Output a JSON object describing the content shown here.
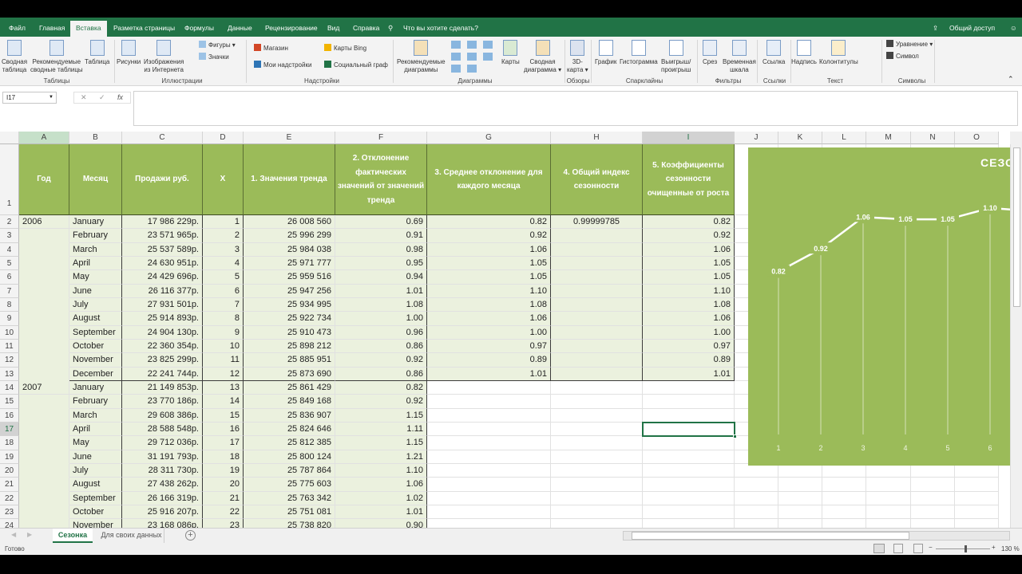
{
  "ribbon_tabs": [
    "Файл",
    "Главная",
    "Вставка",
    "Разметка страницы",
    "Формулы",
    "Данные",
    "Рецензирование",
    "Вид",
    "Справка"
  ],
  "active_tab": "Вставка",
  "tell_me": "Что вы хотите сделать?",
  "share": "Общий доступ",
  "ribbon": {
    "buttons": [
      "Сводная\nтаблица",
      "Рекомендуемые\nсводные таблицы",
      "Таблица",
      "Рисунки",
      "Изображения\nиз Интернета",
      "Рекомендуемые\nдиаграммы",
      "Карты",
      "Сводная\nдиаграмма ▾",
      "3D-\nкарта ▾",
      "График",
      "Гистограмма",
      "Выигрыш/\nпроигрыш",
      "Срез",
      "Временная\nшкала",
      "Ссылка",
      "Надпись",
      "Колонтитулы"
    ],
    "small": [
      "Фигуры ▾",
      "Значки",
      "Магазин",
      "Мои надстройки",
      "Карты Bing",
      "Социальный граф",
      "Уравнение ▾",
      "Символ"
    ],
    "groups": [
      "Таблицы",
      "Иллюстрации",
      "Надстройки",
      "Диаграммы",
      "Обзоры",
      "Спарклайны",
      "Фильтры",
      "Ссылки",
      "Текст",
      "Символы"
    ]
  },
  "formula_bar": {
    "name_box": "I17",
    "formula": ""
  },
  "columns": [
    "A",
    "B",
    "C",
    "D",
    "E",
    "F",
    "G",
    "H",
    "I",
    "J",
    "K",
    "L",
    "M",
    "N",
    "O"
  ],
  "selected_cell": "I17",
  "sheet": {
    "headers": [
      "Год",
      "Месяц",
      "Продажи руб.",
      "X",
      "1. Значения тренда",
      "2. Отклонение фактических значений от значений тренда",
      "3. Среднее отклонение для каждого месяца",
      "4. Общий индекс сезонности",
      "5. Коэффициенты сезонности очищенные от роста"
    ],
    "rows": [
      [
        "2006",
        "January",
        "17 986 229р.",
        "1",
        "26 008 560",
        "0.69",
        "0.82",
        "0.99999785",
        "0.82"
      ],
      [
        "",
        "February",
        "23 571 965р.",
        "2",
        "25 996 299",
        "0.91",
        "0.92",
        "",
        "0.92"
      ],
      [
        "",
        "March",
        "25 537 589р.",
        "3",
        "25 984 038",
        "0.98",
        "1.06",
        "",
        "1.06"
      ],
      [
        "",
        "April",
        "24 630 951р.",
        "4",
        "25 971 777",
        "0.95",
        "1.05",
        "",
        "1.05"
      ],
      [
        "",
        "May",
        "24 429 696р.",
        "5",
        "25 959 516",
        "0.94",
        "1.05",
        "",
        "1.05"
      ],
      [
        "",
        "June",
        "26 116 377р.",
        "6",
        "25 947 256",
        "1.01",
        "1.10",
        "",
        "1.10"
      ],
      [
        "",
        "July",
        "27 931 501р.",
        "7",
        "25 934 995",
        "1.08",
        "1.08",
        "",
        "1.08"
      ],
      [
        "",
        "August",
        "25 914 893р.",
        "8",
        "25 922 734",
        "1.00",
        "1.06",
        "",
        "1.06"
      ],
      [
        "",
        "September",
        "24 904 130р.",
        "9",
        "25 910 473",
        "0.96",
        "1.00",
        "",
        "1.00"
      ],
      [
        "",
        "October",
        "22 360 354р.",
        "10",
        "25 898 212",
        "0.86",
        "0.97",
        "",
        "0.97"
      ],
      [
        "",
        "November",
        "23 825 299р.",
        "11",
        "25 885 951",
        "0.92",
        "0.89",
        "",
        "0.89"
      ],
      [
        "",
        "December",
        "22 241 744р.",
        "12",
        "25 873 690",
        "0.86",
        "1.01",
        "",
        "1.01"
      ],
      [
        "2007",
        "January",
        "21 149 853р.",
        "13",
        "25 861 429",
        "0.82",
        "",
        "",
        ""
      ],
      [
        "",
        "February",
        "23 770 186р.",
        "14",
        "25 849 168",
        "0.92",
        "",
        "",
        ""
      ],
      [
        "",
        "March",
        "29 608 386р.",
        "15",
        "25 836 907",
        "1.15",
        "",
        "",
        ""
      ],
      [
        "",
        "April",
        "28 588 548р.",
        "16",
        "25 824 646",
        "1.11",
        "",
        "",
        ""
      ],
      [
        "",
        "May",
        "29 712 036р.",
        "17",
        "25 812 385",
        "1.15",
        "",
        "",
        ""
      ],
      [
        "",
        "June",
        "31 191 793р.",
        "18",
        "25 800 124",
        "1.21",
        "",
        "",
        ""
      ],
      [
        "",
        "July",
        "28 311 730р.",
        "19",
        "25 787 864",
        "1.10",
        "",
        "",
        ""
      ],
      [
        "",
        "August",
        "27 438 262р.",
        "20",
        "25 775 603",
        "1.06",
        "",
        "",
        ""
      ],
      [
        "",
        "September",
        "26 166 319р.",
        "21",
        "25 763 342",
        "1.02",
        "",
        "",
        ""
      ],
      [
        "",
        "October",
        "25 916 207р.",
        "22",
        "25 751 081",
        "1.01",
        "",
        "",
        ""
      ],
      [
        "",
        "November",
        "23 168 086р.",
        "23",
        "25 738 820",
        "0.90",
        "",
        "",
        ""
      ]
    ]
  },
  "chart_data": {
    "type": "line",
    "title": "СЕЗО",
    "categories": [
      "1",
      "2",
      "3",
      "4",
      "5",
      "6"
    ],
    "values": [
      0.82,
      0.92,
      1.06,
      1.05,
      1.05,
      1.1
    ],
    "data_labels": [
      "0.82",
      "0.92",
      "1.06",
      "1.05",
      "1.05",
      "1.10"
    ],
    "ylim": [
      0,
      1.3
    ],
    "grid": false,
    "drop_lines": true,
    "background": "#9bbb59",
    "line_color": "#ffffff"
  },
  "sheet_tabs": [
    "Сезонка",
    "Для своих данных"
  ],
  "active_sheet": "Сезонка",
  "status": {
    "ready": "Готово",
    "zoom": "130 %"
  },
  "colors": {
    "excel_green": "#217346",
    "header_fill": "#9bbb59",
    "data_fill": "#ebf1de"
  }
}
